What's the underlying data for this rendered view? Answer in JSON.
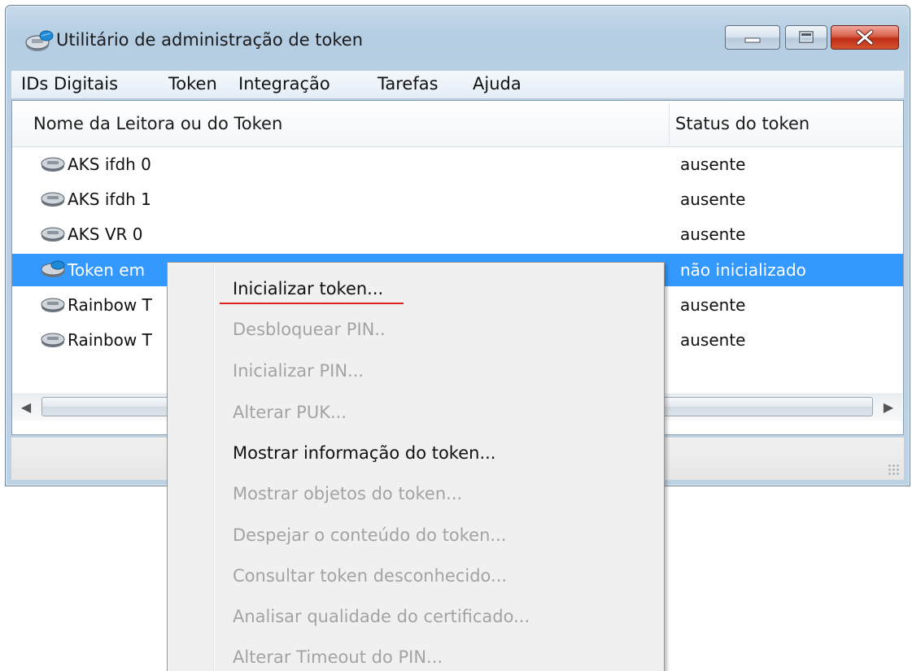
{
  "window": {
    "title": "Utilitário de administração de token"
  },
  "menubar": {
    "items": [
      "IDs Digitais",
      "Token",
      "Integração",
      "Tarefas",
      "Ajuda"
    ]
  },
  "list": {
    "columns": [
      "Nome da Leitora ou do Token",
      "Status do token"
    ],
    "rows": [
      {
        "name": "AKS ifdh 0",
        "status": "ausente",
        "icon": "reader-icon"
      },
      {
        "name": "AKS ifdh 1",
        "status": "ausente",
        "icon": "reader-icon"
      },
      {
        "name": "AKS VR 0",
        "status": "ausente",
        "icon": "reader-icon"
      },
      {
        "name": "Token em ",
        "status": "não inicializado",
        "icon": "token-reader-icon",
        "selected": true
      },
      {
        "name": "Rainbow T",
        "status": "ausente",
        "icon": "reader-icon"
      },
      {
        "name": "Rainbow T",
        "status": "ausente",
        "icon": "reader-icon"
      }
    ]
  },
  "context_menu": {
    "items": [
      {
        "label": "Inicializar token...",
        "enabled": true
      },
      {
        "label": "Desbloquear PIN..",
        "enabled": false
      },
      {
        "label": "Inicializar PIN...",
        "enabled": false
      },
      {
        "label": "Alterar PUK...",
        "enabled": false
      },
      {
        "label": "Mostrar informação do token...",
        "enabled": true
      },
      {
        "label": "Mostrar objetos do token...",
        "enabled": false
      },
      {
        "label": "Despejar o conteúdo do token...",
        "enabled": false
      },
      {
        "label": "Consultar token desconhecido...",
        "enabled": false
      },
      {
        "label": "Analisar qualidade do certificado...",
        "enabled": false
      },
      {
        "label": "Alterar Timeout do PIN...",
        "enabled": false
      }
    ]
  },
  "colors": {
    "selection": "#3399ff",
    "highlight_underline": "#e02020",
    "disabled_text": "#a3a3a3"
  }
}
